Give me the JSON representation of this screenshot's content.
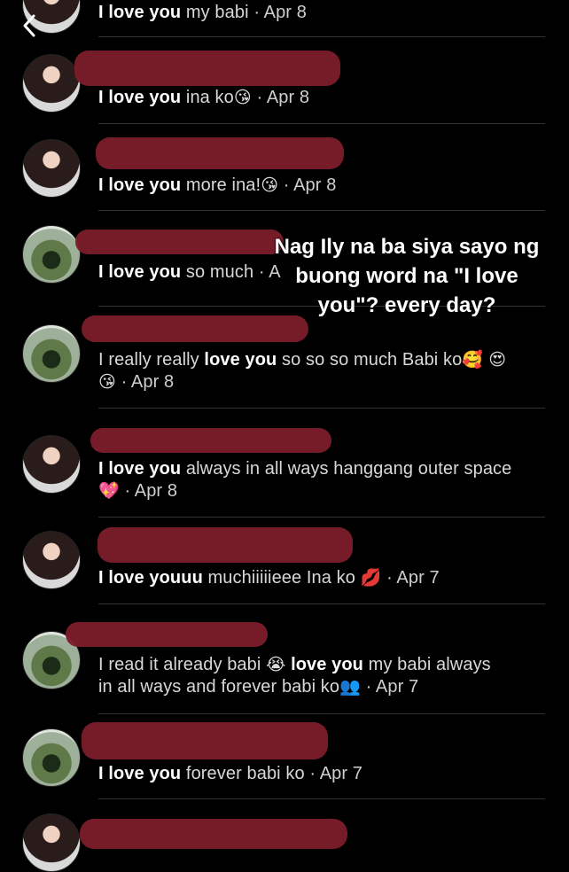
{
  "header": {
    "back_icon": "chevron-left-icon"
  },
  "caption": {
    "text": "Nag Ily na ba siya sayo ng buong word na \"I love you\"? every day?"
  },
  "comments": [
    {
      "avatar": "woman-portrait",
      "bold": "I love you",
      "text": " my babi",
      "emoji": "",
      "date": "Apr 8"
    },
    {
      "avatar": "woman-portrait",
      "bold": "I love you",
      "text": " ina ko",
      "emoji": "😘",
      "date": "Apr 8"
    },
    {
      "avatar": "woman-portrait",
      "bold": "I love you",
      "text": " more ina!",
      "emoji": "😘",
      "date": "Apr 8"
    },
    {
      "avatar": "wedding-photo",
      "bold": "I love you",
      "text": " so much",
      "emoji": "",
      "date": "A"
    },
    {
      "avatar": "wedding-photo",
      "bold": "love you",
      "prefix": "I really really ",
      "text": " so so so much Babi ko",
      "emoji": "🥰 😍",
      "line2_emoji": "😘",
      "date": "Apr 8"
    },
    {
      "avatar": "woman-portrait",
      "bold": "I love you",
      "text": " always in all ways hanggang outer space",
      "emoji": "",
      "line2_emoji": "💖",
      "date": "Apr 8"
    },
    {
      "avatar": "woman-portrait",
      "bold": "I love youuu",
      "text": " muchiiiiieee Ina ko",
      "emoji": "💋",
      "date": "Apr 7"
    },
    {
      "avatar": "wedding-photo",
      "prefix": "I read it already babi ",
      "bold": "love you",
      "text": " my babi always",
      "emoji": "😭",
      "line2": "in all ways and forever babi ko",
      "line2_emoji": "👥",
      "date": "Apr 7"
    },
    {
      "avatar": "wedding-photo",
      "bold": "I love you",
      "text": " forever babi ko",
      "emoji": "",
      "date": "Apr 7"
    },
    {
      "avatar": "woman-portrait",
      "bold": "",
      "text": "",
      "emoji": "",
      "date": ""
    }
  ]
}
